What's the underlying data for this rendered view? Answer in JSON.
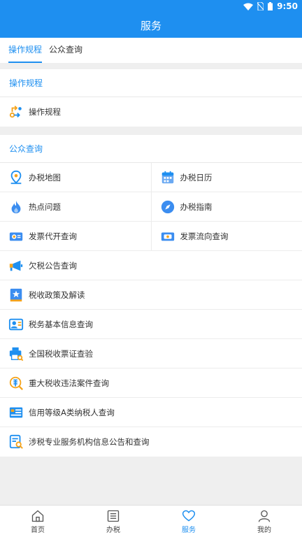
{
  "status": {
    "time": "9:50"
  },
  "header": {
    "title": "服务"
  },
  "tabs": [
    {
      "label": "操作规程",
      "active": true
    },
    {
      "label": "公众查询",
      "active": false
    }
  ],
  "sections": {
    "procedures": {
      "title": "操作规程",
      "items": [
        {
          "label": "操作规程",
          "icon": "process-flow-icon"
        }
      ]
    },
    "public_query": {
      "title": "公众查询",
      "grid": [
        {
          "label": "办税地图",
          "icon": "map-pin-icon"
        },
        {
          "label": "办税日历",
          "icon": "calendar-icon"
        },
        {
          "label": "热点问题",
          "icon": "flame-icon"
        },
        {
          "label": "办税指南",
          "icon": "compass-icon"
        },
        {
          "label": "发票代开查询",
          "icon": "invoice-icon"
        },
        {
          "label": "发票流向查询",
          "icon": "invoice-flow-icon"
        }
      ],
      "list": [
        {
          "label": "欠税公告查询",
          "icon": "megaphone-icon"
        },
        {
          "label": "税收政策及解读",
          "icon": "policy-book-icon"
        },
        {
          "label": "税务基本信息查询",
          "icon": "id-card-icon"
        },
        {
          "label": "全国税收票证查验",
          "icon": "printer-search-icon"
        },
        {
          "label": "重大税收违法案件查询",
          "icon": "tax-search-icon"
        },
        {
          "label": "信用等级A类纳税人查询",
          "icon": "credit-card-icon"
        },
        {
          "label": "涉税专业服务机构信息公告和查询",
          "icon": "document-search-icon"
        }
      ]
    }
  },
  "bottom_nav": [
    {
      "label": "首页",
      "icon": "home-icon",
      "active": false
    },
    {
      "label": "办税",
      "icon": "list-icon",
      "active": false
    },
    {
      "label": "服务",
      "icon": "heart-icon",
      "active": true
    },
    {
      "label": "我的",
      "icon": "user-icon",
      "active": false
    }
  ],
  "colors": {
    "primary": "#1e8ff0",
    "orange": "#f5a31a",
    "background": "#efefef"
  }
}
